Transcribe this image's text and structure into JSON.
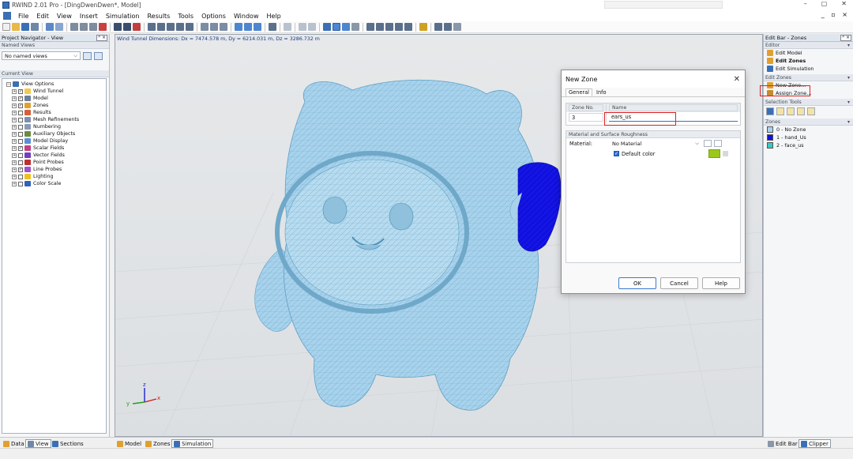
{
  "window": {
    "title": "RWIND 2.01 Pro - [DingDwenDwen*, Model]",
    "controls": [
      "–",
      "▢",
      "✕"
    ]
  },
  "menu": [
    "File",
    "Edit",
    "View",
    "Insert",
    "Simulation",
    "Results",
    "Tools",
    "Options",
    "Window",
    "Help"
  ],
  "mdi_controls": "_ ▫ ×",
  "navigator": {
    "title": "Project Navigator - View",
    "pin": "ᵖ ×",
    "named_views_label": "Named Views",
    "named_views_value": "No named views",
    "current_view_label": "Current View",
    "tree": [
      {
        "label": "View Options",
        "root": true
      },
      {
        "label": "Wind Tunnel",
        "checked": true,
        "color": "#f2c94c"
      },
      {
        "label": "Model",
        "checked": true,
        "color": "#6a7f9a"
      },
      {
        "label": "Zones",
        "checked": true,
        "color": "#e0a030"
      },
      {
        "label": "Results",
        "checked": false,
        "color": "#d65f3a"
      },
      {
        "label": "Mesh Refinements",
        "checked": false,
        "color": "#7e8fb0"
      },
      {
        "label": "Numbering",
        "checked": false,
        "color": "#8a9ab8"
      },
      {
        "label": "Auxiliary Objects",
        "checked": false,
        "color": "#6b8c3e"
      },
      {
        "label": "Model Display",
        "checked": false,
        "color": "#5b8dd6"
      },
      {
        "label": "Scalar Fields",
        "checked": true,
        "color": "#c04080"
      },
      {
        "label": "Vector Fields",
        "checked": false,
        "color": "#7040c0"
      },
      {
        "label": "Point Probes",
        "checked": false,
        "color": "#c03030"
      },
      {
        "label": "Line Probes",
        "checked": true,
        "color": "#a050d0"
      },
      {
        "label": "Lighting",
        "checked": false,
        "color": "#f0c020"
      },
      {
        "label": "Color Scale",
        "checked": false,
        "color": "#3060c0"
      }
    ]
  },
  "viewport": {
    "info": "Wind Tunnel Dimensions: Dx = 7474.578 m, Dy = 6214.031 m, Dz = 3286.732 m"
  },
  "dialog": {
    "title": "New Zone",
    "tabs": [
      "General",
      "Info"
    ],
    "zone_no_label": "Zone No.",
    "name_label": "Name",
    "zone_no": "3",
    "name_value": "ears_us",
    "material_section": "Material and Surface Roughness",
    "material_label": "Material:",
    "material_value": "No Material",
    "default_color_label": "Default color",
    "default_color": "#9bc81a",
    "ok": "OK",
    "cancel": "Cancel",
    "help": "Help"
  },
  "editbar": {
    "title": "Edit Bar - Zones",
    "editor_head": "Editor",
    "editor_items": [
      "Edit Model",
      "Edit Zones",
      "Edit Simulation"
    ],
    "edit_zones_head": "Edit Zones",
    "edit_zones_items": [
      "New Zone...",
      "Assign Zone..."
    ],
    "selection_head": "Selection Tools",
    "zones_head": "Zones",
    "zones": [
      {
        "label": "0 - No Zone",
        "color": "#a8d2ec"
      },
      {
        "label": "1 - hand_Us",
        "color": "#1010e0"
      },
      {
        "label": "2 - face_us",
        "color": "#38c8c8"
      }
    ]
  },
  "bottom_tabs_left": [
    "Data",
    "View",
    "Sections"
  ],
  "bottom_tabs_mid": [
    "Model",
    "Zones",
    "Simulation"
  ],
  "bottom_tabs_right": [
    "Edit Bar",
    "Clipper"
  ],
  "axes": {
    "z": "z",
    "x": "x",
    "y": "y"
  }
}
